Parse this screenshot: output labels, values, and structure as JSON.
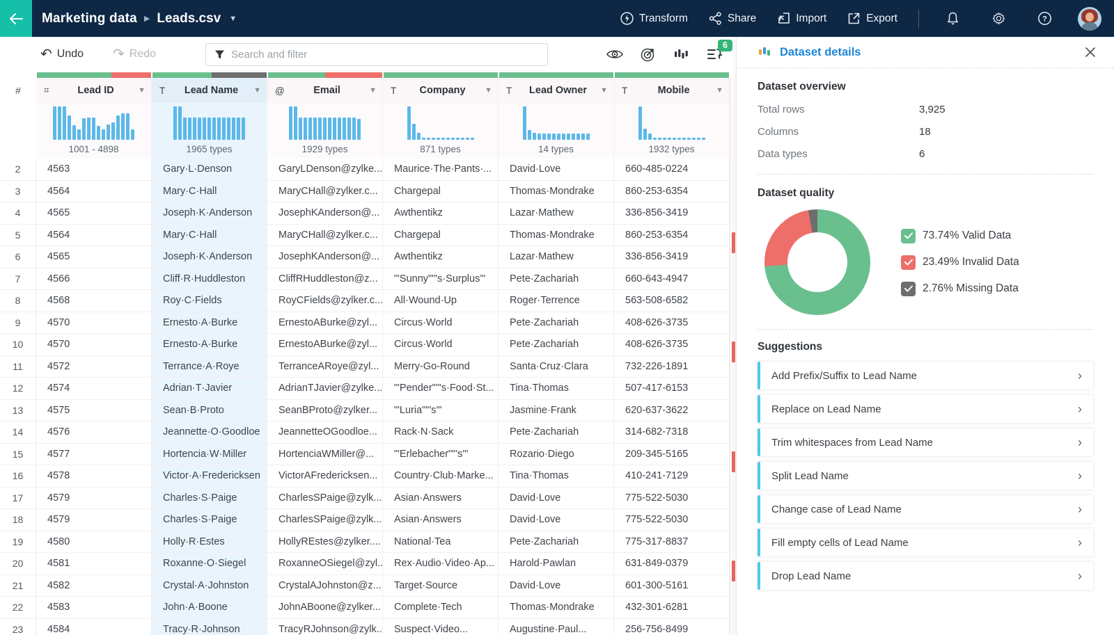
{
  "colors": {
    "topbar": "#0d2745",
    "accent_teal": "#15bfa8",
    "title_blue": "#1d86d8",
    "badge_green": "#35b577",
    "suggestion_accent": "#4fc8ee",
    "hist_bar": "#5cb8e9",
    "valid": "#6abf8e",
    "invalid": "#ee6f6a",
    "missing": "#6e6e6e",
    "invalid_marker": "#e8695e"
  },
  "topbar": {
    "breadcrumb": {
      "dataset": "Marketing data",
      "file": "Leads.csv"
    },
    "actions": [
      {
        "label": "Transform"
      },
      {
        "label": "Share"
      },
      {
        "label": "Import"
      },
      {
        "label": "Export"
      }
    ]
  },
  "toolbar": {
    "undo": "Undo",
    "redo": "Redo",
    "search_placeholder": "Search and filter",
    "steps_badge": "6"
  },
  "table": {
    "row_number_header": "#",
    "columns": [
      {
        "key": "lead-id",
        "type_icon": "⌗",
        "label": "Lead ID",
        "selected": false,
        "quality": [
          {
            "type": "valid",
            "pct": 65
          },
          {
            "type": "invalid",
            "pct": 35
          }
        ],
        "hist": {
          "label": "1001 - 4898",
          "bars": [
            93,
            93,
            93,
            68,
            40,
            28,
            60,
            62,
            62,
            38,
            28,
            42,
            48,
            68,
            73,
            73,
            28
          ]
        }
      },
      {
        "key": "lead-name",
        "type_icon": "T",
        "label": "Lead Name",
        "selected": true,
        "quality": [
          {
            "type": "valid",
            "pct": 52
          },
          {
            "type": "missing",
            "pct": 48
          }
        ],
        "hist": {
          "label": "1965 types",
          "bars": [
            93,
            93,
            62,
            62,
            62,
            62,
            62,
            62,
            62,
            62,
            62,
            62,
            62,
            62,
            62
          ]
        }
      },
      {
        "key": "email",
        "type_icon": "@",
        "label": "Email",
        "selected": false,
        "quality": [
          {
            "type": "valid",
            "pct": 50
          },
          {
            "type": "invalid",
            "pct": 50
          }
        ],
        "hist": {
          "label": "1929 types",
          "bars": [
            93,
            93,
            62,
            62,
            62,
            62,
            62,
            62,
            62,
            62,
            62,
            62,
            62,
            62,
            58
          ]
        }
      },
      {
        "key": "company",
        "type_icon": "T",
        "label": "Company",
        "selected": false,
        "quality": [
          {
            "type": "valid",
            "pct": 100
          }
        ],
        "hist": {
          "label": "871 types",
          "bars": [
            93,
            45,
            20,
            5,
            5,
            5,
            5,
            5,
            5,
            5,
            5,
            5,
            5,
            5
          ]
        }
      },
      {
        "key": "lead-owner",
        "type_icon": "T",
        "label": "Lead Owner",
        "selected": false,
        "quality": [
          {
            "type": "valid",
            "pct": 100
          }
        ],
        "hist": {
          "label": "14 types",
          "bars": [
            93,
            26,
            19,
            18,
            18,
            18,
            18,
            18,
            18,
            18,
            18,
            18,
            18,
            18
          ]
        }
      },
      {
        "key": "mobile",
        "type_icon": "T",
        "label": "Mobile",
        "selected": false,
        "quality": [
          {
            "type": "valid",
            "pct": 100
          }
        ],
        "hist": {
          "label": "1932 types",
          "bars": [
            93,
            30,
            17,
            5,
            5,
            5,
            5,
            5,
            5,
            5,
            5,
            5,
            5,
            5
          ]
        }
      }
    ],
    "rows": [
      {
        "num": "2",
        "cells": [
          "4563",
          "Gary·L·Denson",
          "GaryLDenson@zylke...",
          "Maurice·The·Pants·...",
          "David·Love",
          "660-485-0224"
        ]
      },
      {
        "num": "3",
        "cells": [
          "4564",
          "Mary·C·Hall",
          "MaryCHall@zylker.c...",
          "Chargepal",
          "Thomas·Mondrake",
          "860-253-6354"
        ]
      },
      {
        "num": "4",
        "cells": [
          "4565",
          "Joseph·K·Anderson",
          "JosephKAnderson@...",
          "Awthentikz",
          "Lazar·Mathew",
          "336-856-3419"
        ]
      },
      {
        "num": "5",
        "cells": [
          "4564",
          "Mary·C·Hall",
          "MaryCHall@zylker.c...",
          "Chargepal",
          "Thomas·Mondrake",
          "860-253-6354"
        ]
      },
      {
        "num": "6",
        "cells": [
          "4565",
          "Joseph·K·Anderson",
          "JosephKAnderson@...",
          "Awthentikz",
          "Lazar·Mathew",
          "336-856-3419"
        ]
      },
      {
        "num": "7",
        "cells": [
          "4566",
          "Cliff·R·Huddleston",
          "CliffRHuddleston@z...",
          "\"'Sunny\"\"'s·Surplus'\"",
          "Pete·Zachariah",
          "660-643-4947"
        ]
      },
      {
        "num": "8",
        "cells": [
          "4568",
          "Roy·C·Fields",
          "RoyCFields@zylker.c...",
          "All·Wound·Up",
          "Roger·Terrence",
          "563-508-6582"
        ]
      },
      {
        "num": "9",
        "cells": [
          "4570",
          "Ernesto·A·Burke",
          "ErnestoABurke@zyl...",
          "Circus·World",
          "Pete·Zachariah",
          "408-626-3735"
        ]
      },
      {
        "num": "10",
        "cells": [
          "4570",
          "Ernesto·A·Burke",
          "ErnestoABurke@zyl...",
          "Circus·World",
          "Pete·Zachariah",
          "408-626-3735"
        ]
      },
      {
        "num": "11",
        "cells": [
          "4572",
          "Terrance·A·Roye",
          "TerranceARoye@zyl...",
          "Merry-Go-Round",
          "Santa·Cruz·Clara",
          "732-226-1891"
        ]
      },
      {
        "num": "12",
        "cells": [
          "4574",
          "Adrian·T·Javier",
          "AdrianTJavier@zylke...",
          "\"'Pender\"\"'s·Food·St...",
          "Tina·Thomas",
          "507-417-6153"
        ]
      },
      {
        "num": "13",
        "cells": [
          "4575",
          "Sean·B·Proto",
          "SeanBProto@zylker...",
          "\"'Luria\"\"'s'\"",
          "Jasmine·Frank",
          "620-637-3622"
        ]
      },
      {
        "num": "14",
        "cells": [
          "4576",
          "Jeannette·O·Goodloe",
          "JeannetteOGoodloe...",
          "Rack·N·Sack",
          "Pete·Zachariah",
          "314-682-7318"
        ]
      },
      {
        "num": "15",
        "cells": [
          "4577",
          "Hortencia·W·Miller",
          "HortenciaWMiller@...",
          "\"'Erlebacher\"\"'s'\"",
          "Rozario·Diego",
          "209-345-5165"
        ]
      },
      {
        "num": "16",
        "cells": [
          "4578",
          "Victor·A·Fredericksen",
          "VictorAFredericksen...",
          "Country·Club·Marke...",
          "Tina·Thomas",
          "410-241-7129"
        ]
      },
      {
        "num": "17",
        "cells": [
          "4579",
          "Charles·S·Paige",
          "CharlesSPaige@zylk...",
          "Asian·Answers",
          "David·Love",
          "775-522-5030"
        ]
      },
      {
        "num": "18",
        "cells": [
          "4579",
          "Charles·S·Paige",
          "CharlesSPaige@zylk...",
          "Asian·Answers",
          "David·Love",
          "775-522-5030"
        ]
      },
      {
        "num": "19",
        "cells": [
          "4580",
          "Holly·R·Estes",
          "HollyREstes@zylker....",
          "National·Tea",
          "Pete·Zachariah",
          "775-317-8837"
        ]
      },
      {
        "num": "20",
        "cells": [
          "4581",
          "Roxanne·O·Siegel",
          "RoxanneOSiegel@zyl...",
          "Rex·Audio·Video·Ap...",
          "Harold·Pawlan",
          "631-849-0379"
        ]
      },
      {
        "num": "21",
        "cells": [
          "4582",
          "Crystal·A·Johnston",
          "CrystalAJohnston@z...",
          "Target·Source",
          "David·Love",
          "601-300-5161"
        ]
      },
      {
        "num": "22",
        "cells": [
          "4583",
          "John·A·Boone",
          "JohnABoone@zylker...",
          "Complete·Tech",
          "Thomas·Mondrake",
          "432-301-6281"
        ]
      },
      {
        "num": "23",
        "cells": [
          "4584",
          "Tracy·R·Johnson",
          "TracyRJohnson@zylk...",
          "Suspect·Video...",
          "Augustine·Paul...",
          "256-756-8499"
        ]
      }
    ],
    "invalid_row_markers": [
      5,
      10,
      15,
      20
    ]
  },
  "panel": {
    "title": "Dataset details",
    "overview": {
      "title": "Dataset overview",
      "stats": [
        {
          "label": "Total rows",
          "value": "3,925"
        },
        {
          "label": "Columns",
          "value": "18"
        },
        {
          "label": "Data types",
          "value": "6"
        }
      ]
    },
    "quality": {
      "title": "Dataset quality",
      "segments": [
        {
          "label": "Valid Data",
          "pct": "73.74",
          "color": "#6abf8e"
        },
        {
          "label": "Invalid Data",
          "pct": "23.49",
          "color": "#ee6f6a"
        },
        {
          "label": "Missing Data",
          "pct": "2.76",
          "color": "#6e6e6e"
        }
      ]
    },
    "suggestions": {
      "title": "Suggestions",
      "items": [
        "Add Prefix/Suffix to Lead Name",
        "Replace on Lead Name",
        "Trim whitespaces from Lead Name",
        "Split Lead Name",
        "Change case of Lead Name",
        "Fill empty cells of Lead Name",
        "Drop Lead Name"
      ]
    }
  }
}
